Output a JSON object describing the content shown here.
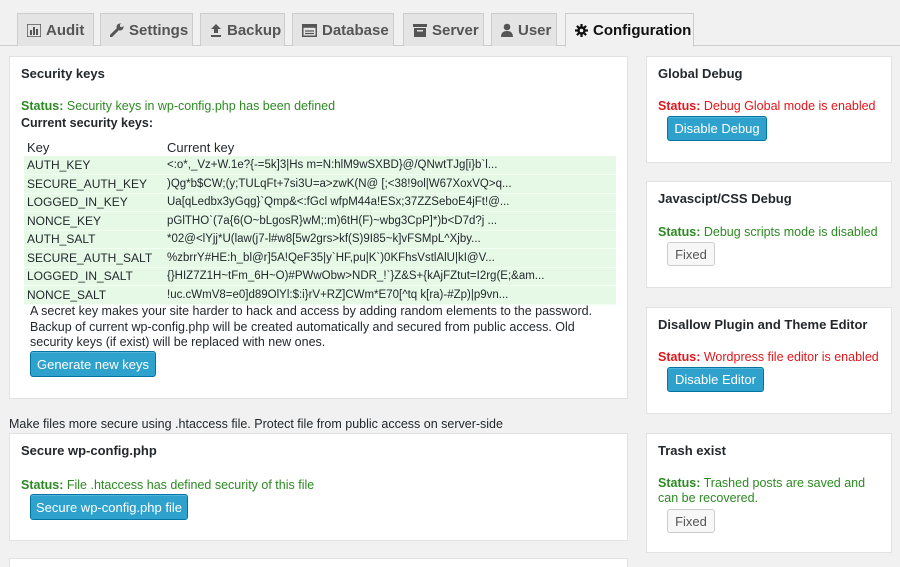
{
  "tabs": [
    {
      "label": "Audit",
      "icon": "bar-chart-icon"
    },
    {
      "label": "Settings",
      "icon": "wrench-icon"
    },
    {
      "label": "Backup",
      "icon": "upload-icon"
    },
    {
      "label": "Database",
      "icon": "database-icon"
    },
    {
      "label": "Server",
      "icon": "server-icon"
    },
    {
      "label": "User",
      "icon": "user-icon"
    },
    {
      "label": "Configuration",
      "icon": "gear-icon"
    }
  ],
  "security_keys": {
    "title": "Security keys",
    "status_label": "Status:",
    "status_text": "Security keys in wp-config.php has been defined",
    "current_label": "Current security keys:",
    "col_key": "Key",
    "col_value": "Current key",
    "rows": [
      {
        "key": "AUTH_KEY",
        "value": "<:o*,_Vz+W.1e?{-=5k]3|Hs m=N:hlM9wSXBD}@/QNwtTJg[i}b`l..."
      },
      {
        "key": "SECURE_AUTH_KEY",
        "value": ")Qg*b$CW;(y;TULqFt+7si3U=a>zwK(N@ [;<38!9ol|W67XoxVQ>q..."
      },
      {
        "key": "LOGGED_IN_KEY",
        "value": "Ua[qLedbx3yGqg}`Qmp&<:fGcl wfpM44a!ESx;37ZZSeboE4jFt!@..."
      },
      {
        "key": "NONCE_KEY",
        "value": "pGlTHO`(7a{6(O~bLgosR}wM;:m)6tH(F)~wbg3CpP]*)b<D7d?j ..."
      },
      {
        "key": "AUTH_SALT",
        "value": "*02@<lYjj*U(law(j7-l#w8[5w2grs>kf(S)9I85~k]vFSMpL^Xjby..."
      },
      {
        "key": "SECURE_AUTH_SALT",
        "value": "%zbrrY#HE:h_bl@r]5A!QeF35|y`HF,pu|K`)0KFhsVstlAlU|kI@V..."
      },
      {
        "key": "LOGGED_IN_SALT",
        "value": "{}HIZ7Z1H~tFm_6H~O)#PWwObw>NDR_!`}Z&S+{kAjFZtut=I2rg(E;&am..."
      },
      {
        "key": "NONCE_SALT",
        "value": "!uc.cWmV8=e0]d89OlYl:$:i}rV+RZ]CWm*E70[^tq k[ra)-#Zp)|p9vn..."
      }
    ],
    "description_1": "A secret key makes your site harder to hack and access by adding random elements to the password.",
    "description_2": "Backup of current wp-config.php will be created automatically and secured from public access. Old",
    "description_3": "security keys (if exist) will be replaced with new ones.",
    "button": "Generate new keys"
  },
  "htaccess_note": "Make files more secure using .htaccess file. Protect file from public access on server-side",
  "secure_wpconfig": {
    "title": "Secure wp-config.php",
    "status_label": "Status:",
    "status_text": "File .htaccess has defined security of this file",
    "button": "Secure wp-config.php file"
  },
  "global_debug": {
    "title": "Global Debug",
    "status_label": "Status:",
    "status_text": "Debug Global mode is enabled",
    "button": "Disable Debug"
  },
  "js_css_debug": {
    "title": "Javascipt/CSS Debug",
    "status_label": "Status:",
    "status_text": "Debug scripts mode is disabled",
    "button": "Fixed"
  },
  "disallow_editor": {
    "title": "Disallow Plugin and Theme Editor",
    "status_label": "Status:",
    "status_text": "Wordpress file editor is enabled",
    "button": "Disable Editor"
  },
  "trash": {
    "title": "Trash exist",
    "status_label": "Status:",
    "status_text_1": "Trashed posts are saved and",
    "status_text_2": "can be recovered.",
    "button": "Fixed"
  }
}
